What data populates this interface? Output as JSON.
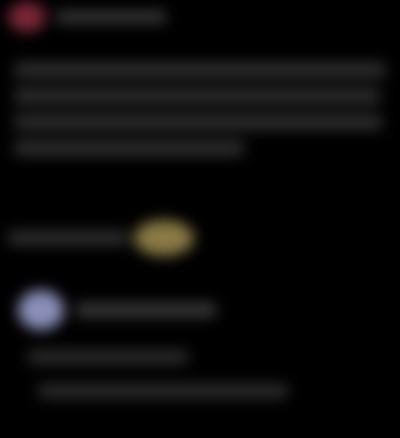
{
  "colors": {
    "background": "#000000",
    "header_avatar": "#7a2638",
    "coin_badge": "#8a7a45",
    "reply_avatar": "#8b8fb8",
    "text_placeholder": "#2c2c2c"
  },
  "header": {
    "title": ""
  },
  "post": {
    "lines": [
      "",
      "",
      "",
      ""
    ]
  },
  "actions": {
    "label": ""
  },
  "reply": {
    "title": "",
    "lines": [
      "",
      ""
    ]
  }
}
